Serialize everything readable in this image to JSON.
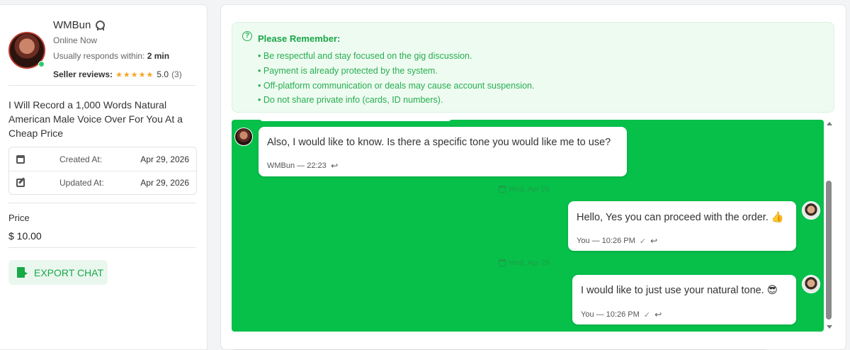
{
  "seller": {
    "name": "WMBun",
    "status": "Online Now",
    "responds_prefix": "Usually responds within:",
    "responds_value": "2 min",
    "reviews_label": "Seller reviews:",
    "stars": "★★★★★",
    "rating": "5.0",
    "review_count": "(3)"
  },
  "gig": {
    "title": "I Will Record a 1,000 Words Natural American Male Voice Over For You At a Cheap Price",
    "created_label": "Created At:",
    "created_value": "Apr 29, 2026",
    "updated_label": "Updated At:",
    "updated_value": "Apr 29, 2026",
    "price_label": "Price",
    "price_value": "$ 10.00"
  },
  "actions": {
    "export_label": "EXPORT CHAT"
  },
  "notice": {
    "title": "Please Remember:",
    "items": [
      "Be respectful and stay focused on the gig discussion.",
      "Payment is already protected by the system.",
      "Off-platform communication or deals may cause account suspension.",
      "Do not share private info (cards, ID numbers)."
    ]
  },
  "messages": [
    {
      "text": "Also, I would like to know. Is there a specific tone you would like me to use?",
      "meta": "WMBun — 22:23"
    },
    {
      "text": "Hello, Yes you can proceed with the order. 👍",
      "meta": "You — 10:26 PM"
    },
    {
      "text": "I would like to just use your natural tone. 😎",
      "meta": "You — 10:26 PM"
    }
  ],
  "date_separators": [
    "Wed, Apr 29",
    "Wed, Apr 29"
  ],
  "colors": {
    "chat_background": "#06c04a",
    "accent_green": "#18a948",
    "star": "#f5a623",
    "notice_bg": "#eefbf1"
  }
}
